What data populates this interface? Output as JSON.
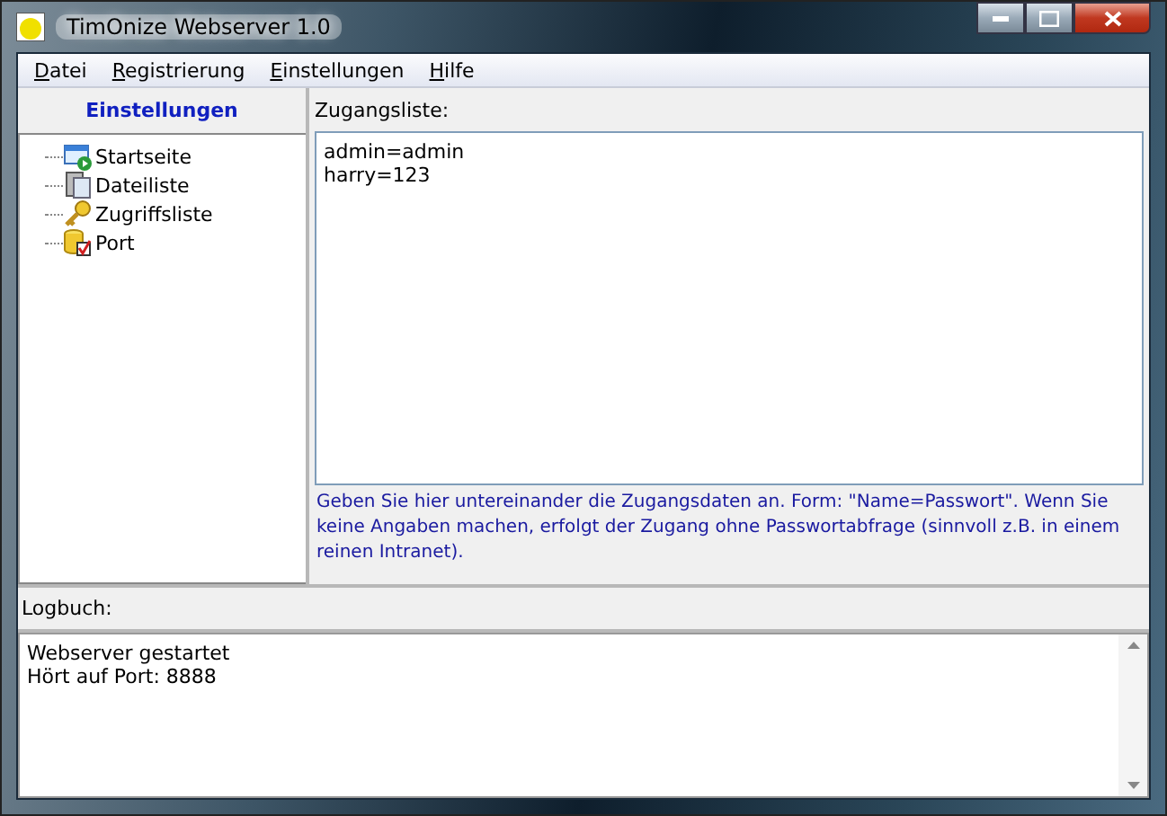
{
  "window": {
    "title": "TimOnize Webserver 1.0"
  },
  "menu": [
    "Datei",
    "Registrierung",
    "Einstellungen",
    "Hilfe"
  ],
  "sidebar": {
    "title": "Einstellungen",
    "items": [
      {
        "label": "Startseite",
        "kind": "page"
      },
      {
        "label": "Dateiliste",
        "kind": "files"
      },
      {
        "label": "Zugriffsliste",
        "kind": "key"
      },
      {
        "label": "Port",
        "kind": "port"
      }
    ]
  },
  "access_list": {
    "label": "Zugangsliste:",
    "value": "admin=admin\nharry=123",
    "hint": "Geben Sie hier untereinander die Zugangsdaten an. Form: \"Name=Passwort\". Wenn Sie keine Angaben machen, erfolgt der Zugang ohne Passwortabfrage (sinnvoll z.B. in einem reinen Intranet)."
  },
  "log": {
    "label": "Logbuch:",
    "value": "Webserver gestartet\nHört auf Port: 8888"
  }
}
